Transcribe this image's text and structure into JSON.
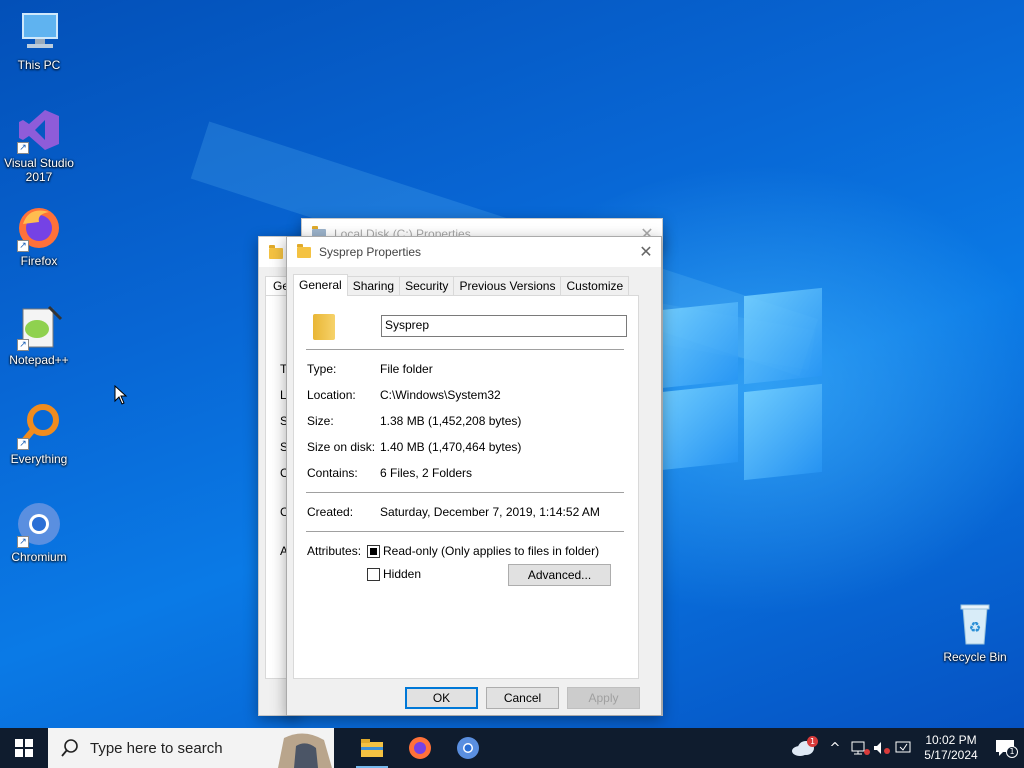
{
  "desktop": {
    "icons": [
      {
        "label": "This PC",
        "icon": "computer-icon"
      },
      {
        "label": "Visual Studio 2017",
        "icon": "visual-studio-icon"
      },
      {
        "label": "Firefox",
        "icon": "firefox-icon"
      },
      {
        "label": "Notepad++",
        "icon": "notepadpp-icon"
      },
      {
        "label": "Everything",
        "icon": "everything-search-icon"
      },
      {
        "label": "Chromium",
        "icon": "chromium-icon"
      },
      {
        "label": "Recycle Bin",
        "icon": "recycle-bin-icon"
      }
    ]
  },
  "bg_window_1": {
    "title": "Local Disk (C:) Properties"
  },
  "bg_window_2": {
    "tab_partial": "Ge",
    "labels_partial": [
      "T",
      "L",
      "S",
      "S",
      "C",
      "C",
      "A"
    ]
  },
  "dialog": {
    "title": "Sysprep Properties",
    "tabs": [
      "General",
      "Sharing",
      "Security",
      "Previous Versions",
      "Customize"
    ],
    "active_tab": "General",
    "name_value": "Sysprep",
    "fields": [
      {
        "key": "Type:",
        "value": "File folder"
      },
      {
        "key": "Location:",
        "value": "C:\\Windows\\System32"
      },
      {
        "key": "Size:",
        "value": "1.38 MB (1,452,208 bytes)"
      },
      {
        "key": "Size on disk:",
        "value": "1.40 MB (1,470,464 bytes)"
      },
      {
        "key": "Contains:",
        "value": "6 Files, 2 Folders"
      }
    ],
    "created_label": "Created:",
    "created_value": "Saturday, December 7, 2019, 1:14:52 AM",
    "attributes_label": "Attributes:",
    "readonly_label": "Read-only (Only applies to files in folder)",
    "readonly_state": "indeterminate",
    "hidden_label": "Hidden",
    "hidden_checked": false,
    "advanced_button": "Advanced...",
    "ok_button": "OK",
    "cancel_button": "Cancel",
    "apply_button": "Apply"
  },
  "taskbar": {
    "search_placeholder": "Type here to search",
    "apps": [
      "file-explorer-icon",
      "firefox-icon",
      "chromium-icon"
    ],
    "weather_badge": "1",
    "time": "10:02 PM",
    "date": "5/17/2024",
    "notification_count": "1"
  },
  "colors": {
    "accent": "#0078d7",
    "taskbar": "#0f1c2e",
    "folder": "#f4c242"
  }
}
